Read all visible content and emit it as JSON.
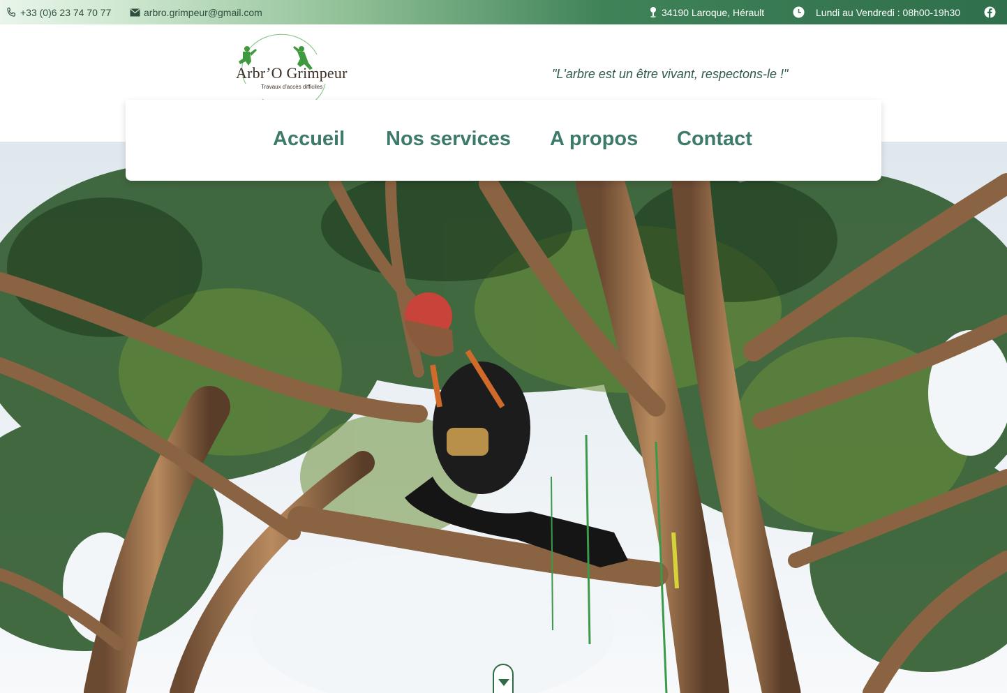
{
  "topbar": {
    "phone": "+33 (0)6 23 74 70 77",
    "email": "arbro.grimpeur@gmail.com",
    "address": "34190 Laroque, Hérault",
    "hours": "Lundi au Vendredi : 08h00-19h30",
    "icons": [
      "phone-icon",
      "mail-icon",
      "location-pin-icon",
      "clock-icon",
      "facebook-icon"
    ]
  },
  "header": {
    "logo_name": "Arbr’O Grimpeur",
    "logo_tagline": "Travaux d'accès difficiles",
    "quote": "\"L'arbre est un être vivant, respectons-le !\""
  },
  "nav": {
    "items": [
      "Accueil",
      "Nos services",
      "A propos",
      "Contact"
    ]
  },
  "colors": {
    "topbar_start": "#e9f5ea",
    "topbar_end": "#2f6f4c",
    "nav_text": "#3e7a6a",
    "quote_text": "#2f5a49",
    "accent_green": "#2f6b45"
  },
  "hero": {
    "icons": [
      "scroll-down-icon"
    ]
  }
}
